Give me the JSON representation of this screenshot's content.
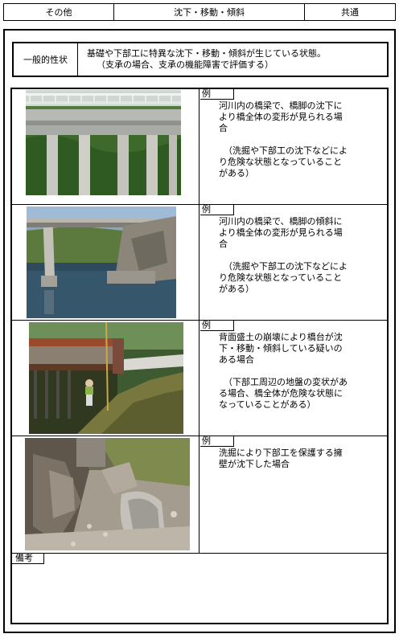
{
  "header": {
    "category": "その他",
    "title": "沈下・移動・傾斜",
    "scope": "共通"
  },
  "general": {
    "label": "一般的性状",
    "line1": "基礎や下部工に特異な沈下・移動・傾斜が生じている状態。",
    "line2": "（支承の場合、支承の機能障害で評価する）"
  },
  "examples": [
    {
      "tag": "例",
      "lines": [
        "河川内の橋梁で、橋脚の沈下に",
        "より橋全体の変形が見られる場",
        "合"
      ],
      "note": [
        "（洗掘や下部工の沈下などによ",
        "り危険な状態となっていること",
        "がある）"
      ]
    },
    {
      "tag": "例",
      "lines": [
        "河川内の橋梁で、橋脚の傾斜に",
        "より橋全体の変形が見られる場",
        "合"
      ],
      "note": [
        "（洗掘や下部工の沈下などによ",
        "り危険な状態となっていること",
        "がある）"
      ]
    },
    {
      "tag": "例",
      "lines": [
        "背面盛土の崩壊により橋台が沈",
        "下・移動・傾斜している疑いの",
        "ある場合"
      ],
      "note": [
        "（下部工周辺の地盤の変状があ",
        "る場合、橋全体が危険な状態に",
        "なっていることがある）"
      ]
    },
    {
      "tag": "例",
      "lines": [
        "洗掘により下部工を保護する擁",
        "壁が沈下した場合"
      ],
      "note": []
    }
  ],
  "remarks": {
    "label": "備考"
  }
}
